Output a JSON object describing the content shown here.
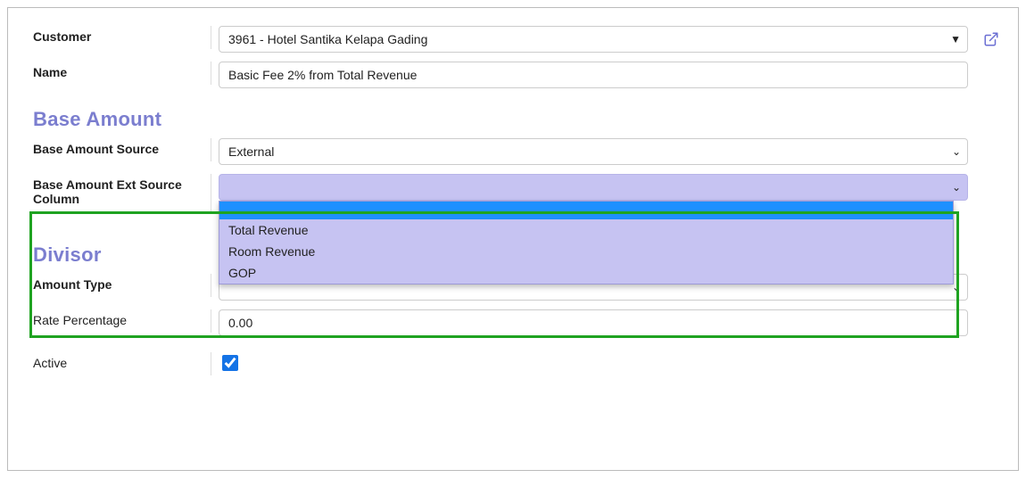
{
  "form": {
    "customer_label": "Customer",
    "customer_value": "3961 - Hotel Santika Kelapa Gading",
    "name_label": "Name",
    "name_value": "Basic Fee 2% from Total Revenue"
  },
  "base_amount": {
    "heading": "Base Amount",
    "source_label": "Base Amount Source",
    "source_value": "External",
    "ext_col_label": "Base Amount Ext Source Column",
    "ext_col_value": "",
    "ext_col_options": {
      "blank": "",
      "opt1": "Total Revenue",
      "opt2": "Room Revenue",
      "opt3": "GOP"
    }
  },
  "divisor": {
    "heading": "Divisor",
    "amount_type_label": "Amount Type",
    "amount_type_value": "",
    "rate_pct_label": "Rate Percentage",
    "rate_pct_value": "0.00"
  },
  "active": {
    "label": "Active",
    "checked": true
  }
}
